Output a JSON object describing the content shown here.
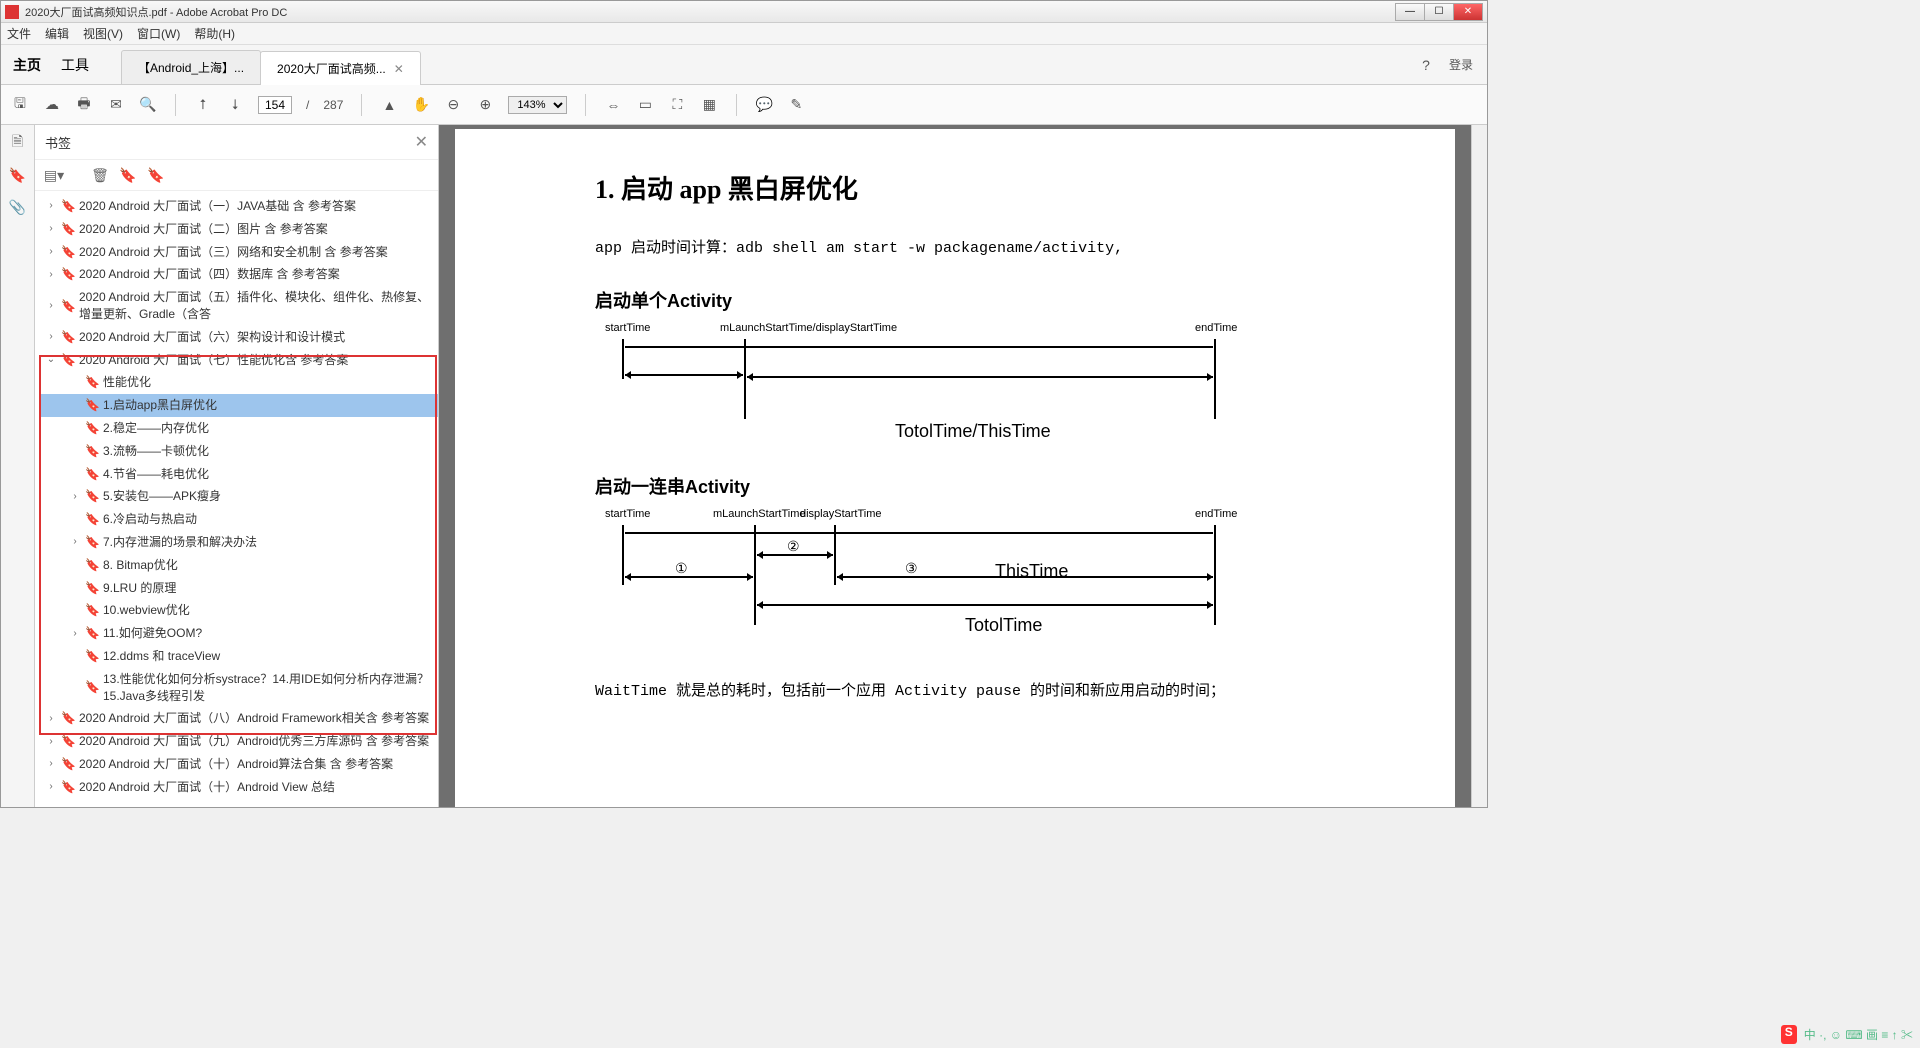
{
  "window": {
    "title": "2020大厂面试高频知识点.pdf - Adobe Acrobat Pro DC"
  },
  "menubar": {
    "file": "文件",
    "edit": "编辑",
    "view": "视图(V)",
    "window": "窗口(W)",
    "help": "帮助(H)"
  },
  "tabbar": {
    "home": "主页",
    "tools": "工具",
    "tab1": "【Android_上海】...",
    "tab2": "2020大厂面试高频...",
    "login": "登录"
  },
  "toolbar": {
    "page_current": "154",
    "page_sep": "/",
    "page_total": "287",
    "zoom": "143%"
  },
  "panel": {
    "title": "书签"
  },
  "bookmarks": {
    "b0": "2020 Android 大厂面试（一）JAVA基础 含 参考答案",
    "b1": "2020 Android 大厂面试（二）图片 含 参考答案",
    "b2": "2020 Android 大厂面试（三）网络和安全机制 含 参考答案",
    "b3": "2020 Android 大厂面试（四）数据库 含 参考答案",
    "b4": "2020 Android 大厂面试（五）插件化、模块化、组件化、热修复、增量更新、Gradle（含答",
    "b5": "2020 Android 大厂面试（六）架构设计和设计模式",
    "b6": "2020 Android 大厂面试（七）性能优化含 参考答案",
    "c0": "性能优化",
    "c1": "1.启动app黑白屏优化",
    "c2": "2.稳定——内存优化",
    "c3": "3.流畅——卡顿优化",
    "c4": "4.节省——耗电优化",
    "c5": "5.安装包——APK瘦身",
    "c6": "6.冷启动与热启动",
    "c7": "7.内存泄漏的场景和解决办法",
    "c8": "8. Bitmap优化",
    "c9": "9.LRU 的原理",
    "c10": "10.webview优化",
    "c11": "11.如何避免OOM?",
    "c12": "12.ddms 和 traceView",
    "c13": "13.性能优化如何分析systrace？14.用IDE如何分析内存泄漏？15.Java多线程引发",
    "b7": "2020 Android 大厂面试（八）Android Framework相关含 参考答案",
    "b8": "2020 Android 大厂面试（九）Android优秀三方库源码 含 参考答案",
    "b9": "2020 Android 大厂面试（十）Android算法合集  含 参考答案",
    "b10": "2020 Android 大厂面试（十）Android View 总结"
  },
  "doc": {
    "heading": "1. 启动 app 黑白屏优化",
    "cmd_prefix": "app 启动时间计算：",
    "cmd": "adb shell am start -w packagename/activity,",
    "sec1": "启动单个Activity",
    "sec2": "启动一连串Activity",
    "d1": {
      "startTime": "startTime",
      "mLaunch": "mLaunchStartTime/displayStartTime",
      "endTime": "endTime",
      "total": "TotolTime/ThisTime"
    },
    "d2": {
      "startTime": "startTime",
      "mLaunch": "mLaunchStartTime",
      "display": "displayStartTime",
      "endTime": "endTime",
      "n1": "①",
      "n2": "②",
      "n3": "③",
      "thisTime": "ThisTime",
      "total": "TotolTime"
    },
    "explain": "WaitTime 就是总的耗时，包括前一个应用 Activity pause 的时间和新应用启动的时间；"
  },
  "tray": {
    "ime": "中 ·, ☺ ⌨ 画 ≡ ↑ ✂"
  }
}
